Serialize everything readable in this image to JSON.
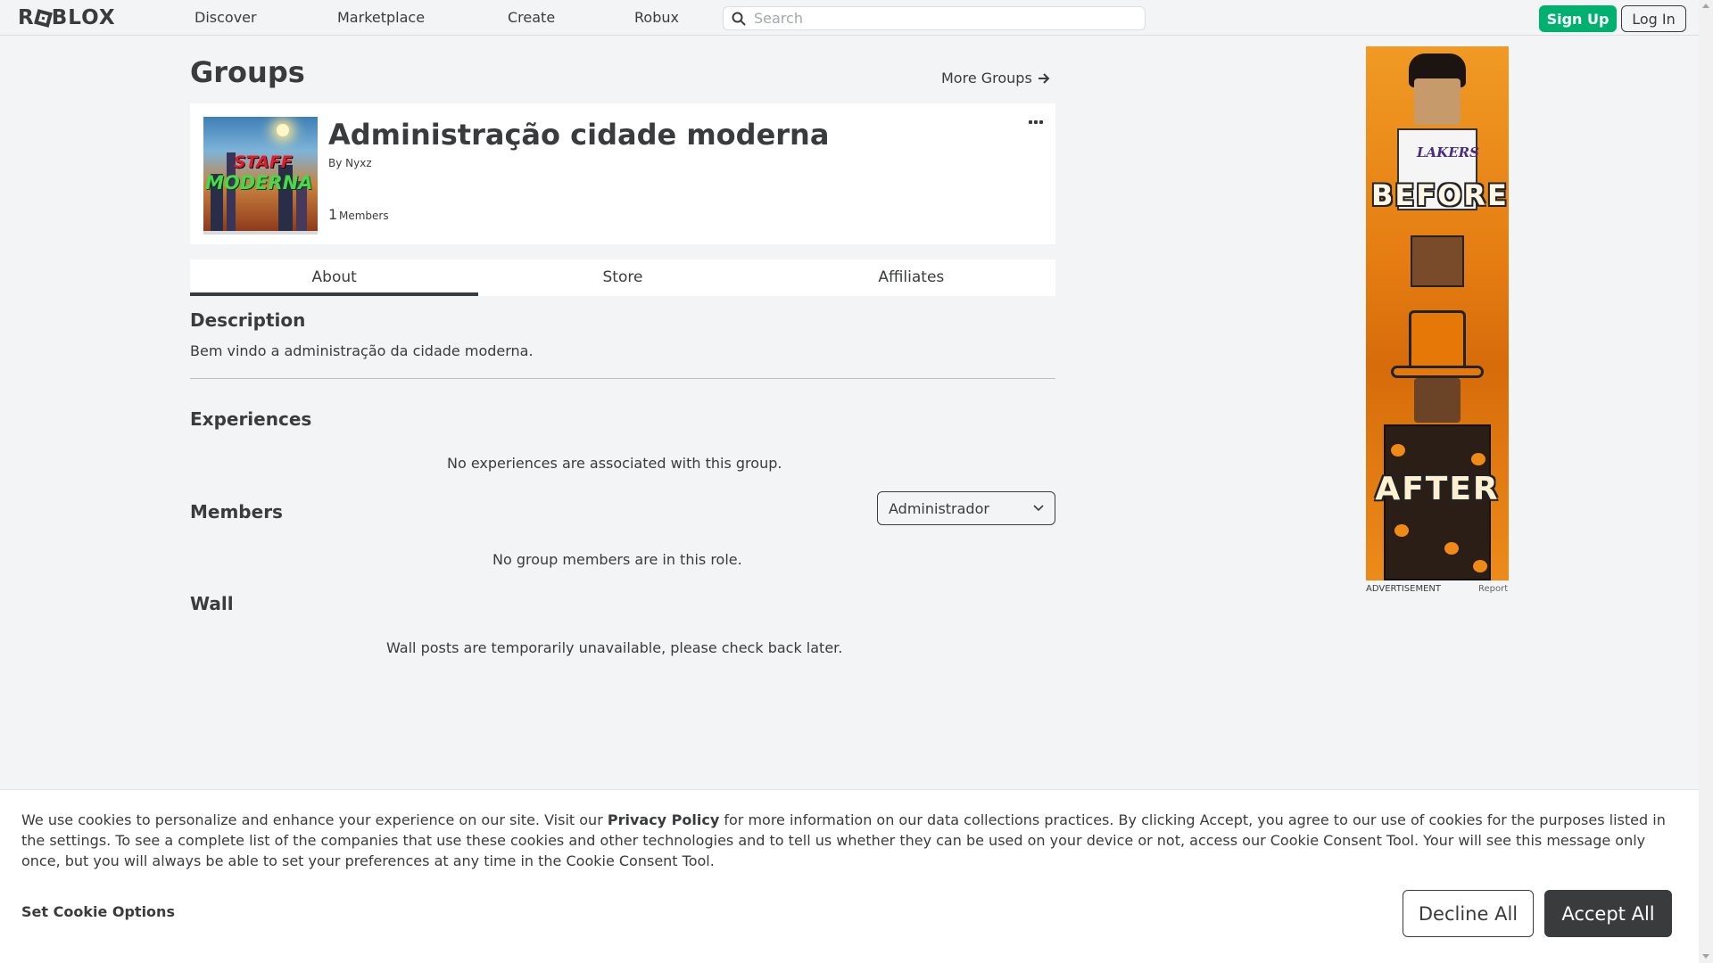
{
  "nav": {
    "logo": "ROBLOX",
    "links": [
      "Discover",
      "Marketplace",
      "Create",
      "Robux"
    ],
    "search_placeholder": "Search",
    "signup_label": "Sign Up",
    "login_label": "Log In"
  },
  "page": {
    "title": "Groups",
    "more_groups": "More Groups"
  },
  "group": {
    "thumb_line1": "STAFF",
    "thumb_line2": "MODERNA",
    "name": "Administração cidade moderna",
    "by_prefix": "By",
    "owner": "Nyxz",
    "member_count": "1",
    "member_label": "Members"
  },
  "tabs": [
    {
      "label": "About",
      "active": true
    },
    {
      "label": "Store",
      "active": false
    },
    {
      "label": "Affiliates",
      "active": false
    }
  ],
  "description": {
    "title": "Description",
    "text": "Bem vindo a administração da cidade moderna."
  },
  "experiences": {
    "title": "Experiences",
    "empty_text": "No experiences are associated with this group."
  },
  "members": {
    "title": "Members",
    "selected_role": "Administrador",
    "empty_text": "No group members are in this role."
  },
  "wall": {
    "title": "Wall",
    "empty_text": "Wall posts are temporarily unavailable, please check back later."
  },
  "ad": {
    "label": "ADVERTISEMENT",
    "report": "Report",
    "jersey_text": "LAKERS",
    "text_before": "BEFORE",
    "text_after": "AFTER"
  },
  "cookie": {
    "text_part1": "We use cookies to personalize and enhance your experience on our site. Visit our ",
    "privacy_link": "Privacy Policy",
    "text_part2": " for more information on our data collections practices. By clicking Accept, you agree to our use of cookies for the purposes listed in the settings. To see a complete list of the companies that use these cookies and other technologies and to tell us whether they can be used on your device or not, access our Cookie Consent Tool. Your will see this message only once, but you will always be able to set your preferences at any time in the Cookie Consent Tool.",
    "options_label": "Set Cookie Options",
    "decline_label": "Decline All",
    "accept_label": "Accept All"
  },
  "colors": {
    "background": "#f2f4f5",
    "text": "#393b3d",
    "signup_green": "#00b06f",
    "accept_dark": "#393b3d"
  },
  "icons": [
    "search-icon",
    "arrow-right-icon",
    "more-dots-icon",
    "chevron-down-icon"
  ]
}
